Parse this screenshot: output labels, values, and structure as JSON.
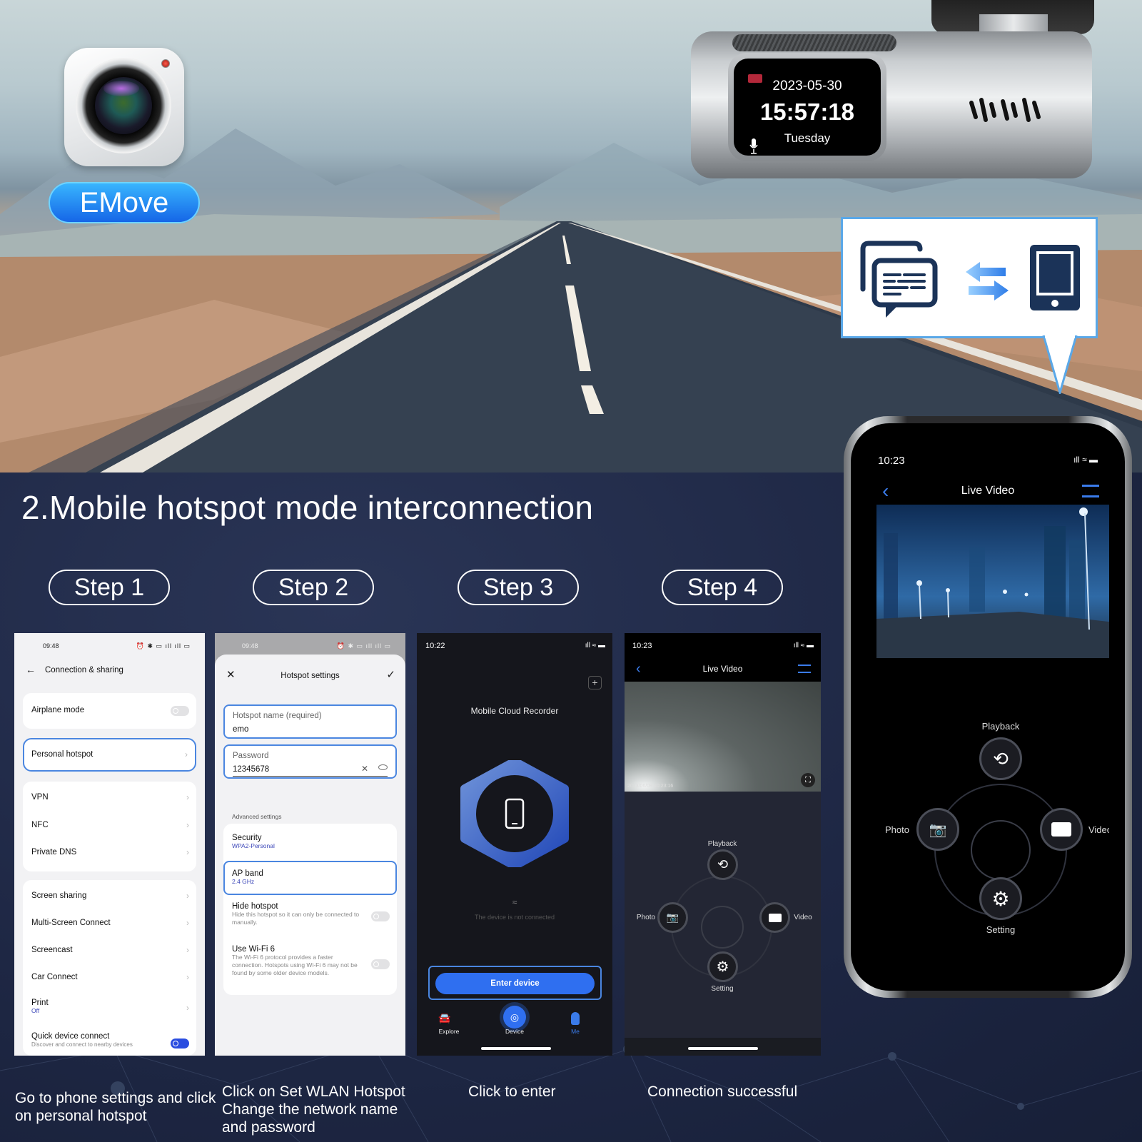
{
  "hero": {
    "app_name": "EMove",
    "dashcam": {
      "date": "2023-05-30",
      "time": "15:57:18",
      "day": "Tuesday"
    },
    "bubble_icons": [
      "chat-icon",
      "swap-arrows-icon",
      "tablet-icon"
    ]
  },
  "section": {
    "title": "2.Mobile hotspot mode interconnection",
    "steps": [
      {
        "label": "Step 1",
        "caption": "Go to phone settings and click on personal hotspot"
      },
      {
        "label": "Step 2",
        "caption": "Click on Set WLAN Hotspot Change the network name and password"
      },
      {
        "label": "Step 3",
        "caption": "Click to enter"
      },
      {
        "label": "Step 4",
        "caption": "Connection successful"
      }
    ]
  },
  "screen1": {
    "status_time": "09:48",
    "title": "Connection & sharing",
    "airplane": "Airplane mode",
    "hotspot": "Personal hotspot",
    "group2": [
      "VPN",
      "NFC",
      "Private DNS"
    ],
    "group3": [
      "Screen sharing",
      "Multi-Screen Connect",
      "Screencast",
      "Car Connect"
    ],
    "print_label": "Print",
    "print_value": "Off",
    "quick_label": "Quick device connect",
    "quick_desc": "Discover and connect to nearby devices"
  },
  "screen2": {
    "status_time": "09:48",
    "title": "Hotspot settings",
    "name_label": "Hotspot name (required)",
    "name_value": "emo",
    "password_label": "Password",
    "password_value": "12345678",
    "advanced": "Advanced settings",
    "security_label": "Security",
    "security_value": "WPA2-Personal",
    "band_label": "AP band",
    "band_value": "2.4 GHz",
    "hide_label": "Hide hotspot",
    "hide_desc": "Hide this hotspot so it can only be connected to manually.",
    "wifi6_label": "Use Wi-Fi 6",
    "wifi6_desc": "The Wi-Fi 6 protocol provides a faster connection. Hotspots using Wi-Fi 6 may not be found by some older device models."
  },
  "screen3": {
    "status_time": "10:22",
    "title": "Mobile Cloud Recorder",
    "status_text": "The device is not connected",
    "enter_button": "Enter device",
    "tabs": [
      "Explore",
      "Device",
      "Me"
    ]
  },
  "screen4": {
    "status_time": "10:23",
    "title": "Live Video",
    "video_timestamp": "2023/06/09  10:23:16",
    "controls": {
      "top": "Playback",
      "left": "Photo",
      "right": "Video",
      "bottom": "Setting"
    }
  },
  "big_phone": {
    "status_time": "10:23",
    "title": "Live Video",
    "controls": {
      "top": "Playback",
      "left": "Photo",
      "right": "Video",
      "bottom": "Setting"
    }
  },
  "colors": {
    "accent_blue": "#2f6ff0",
    "highlight_border": "#4a86e0",
    "dark_bg": "#1e2744",
    "ios_blue": "#3a7bea"
  }
}
